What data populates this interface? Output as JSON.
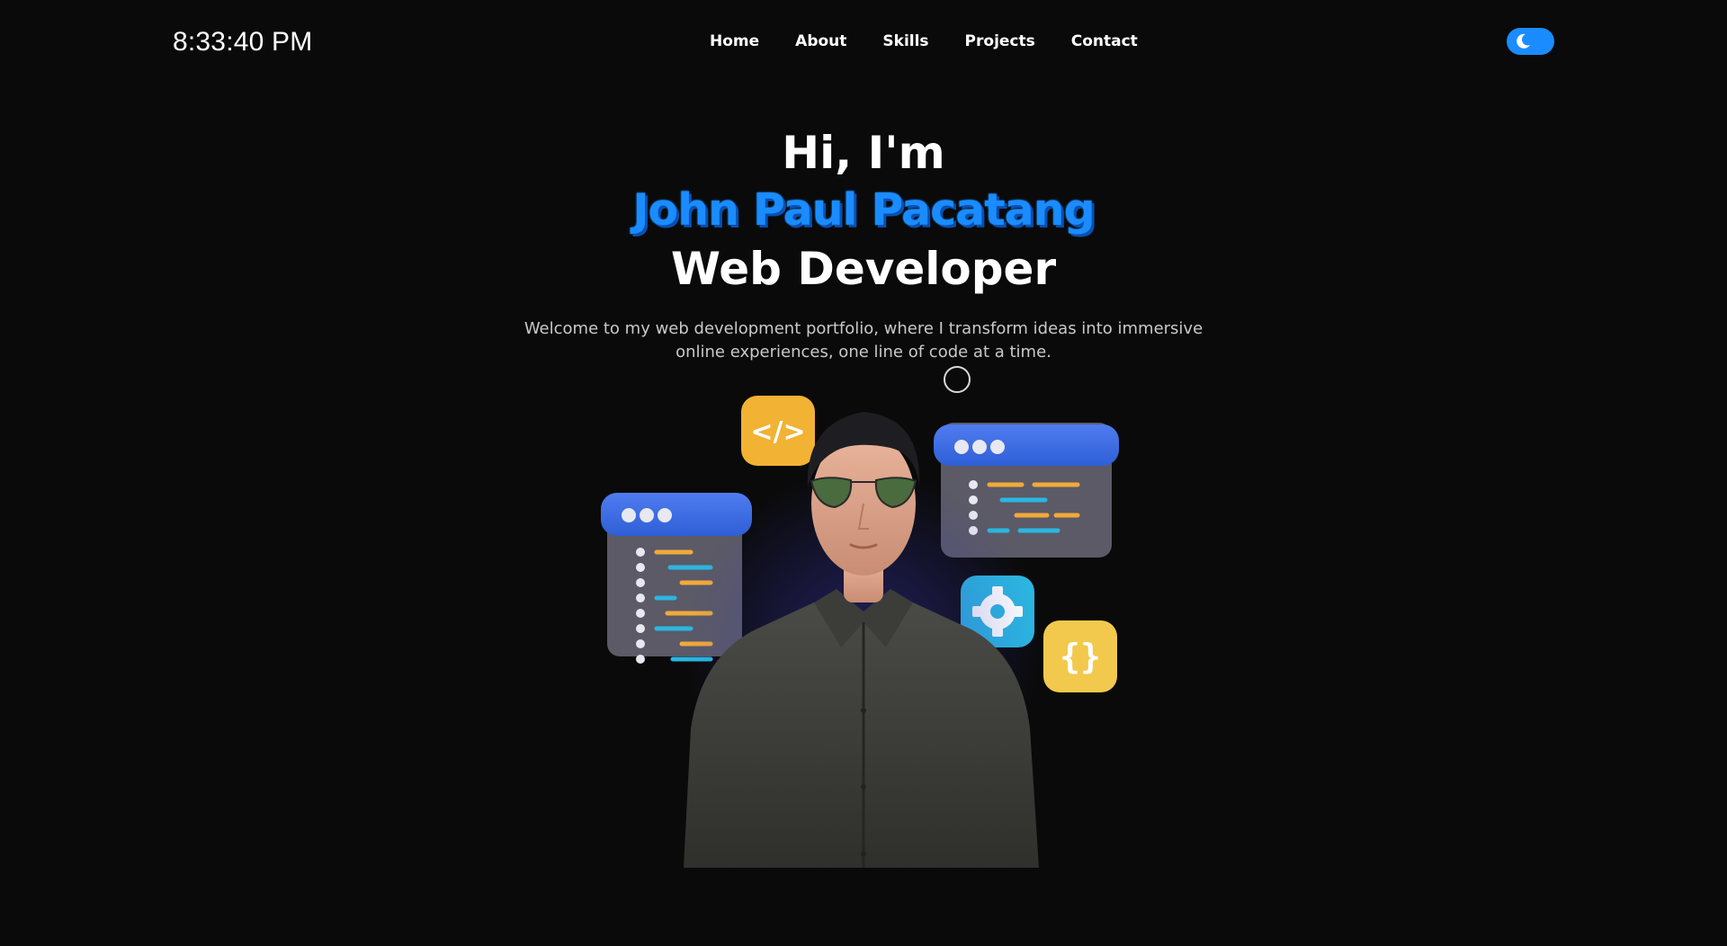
{
  "header": {
    "clock": "8:33:40 PM",
    "nav": [
      "Home",
      "About",
      "Skills",
      "Projects",
      "Contact"
    ],
    "theme_toggle_icon": "moon-icon",
    "accent_color": "#1a8cff"
  },
  "hero": {
    "greeting": "Hi, I'm",
    "name": "John Paul Pacatang",
    "role": "Web Developer",
    "intro": "Welcome to my web development portfolio, where I transform ideas into immersive online experiences, one line of code at a time."
  },
  "illustration": {
    "icons": [
      "code-tag-icon",
      "gear-icon",
      "curly-braces-icon",
      "code-window-icon"
    ],
    "code_tag_text": "</>",
    "braces_text": "{}"
  }
}
